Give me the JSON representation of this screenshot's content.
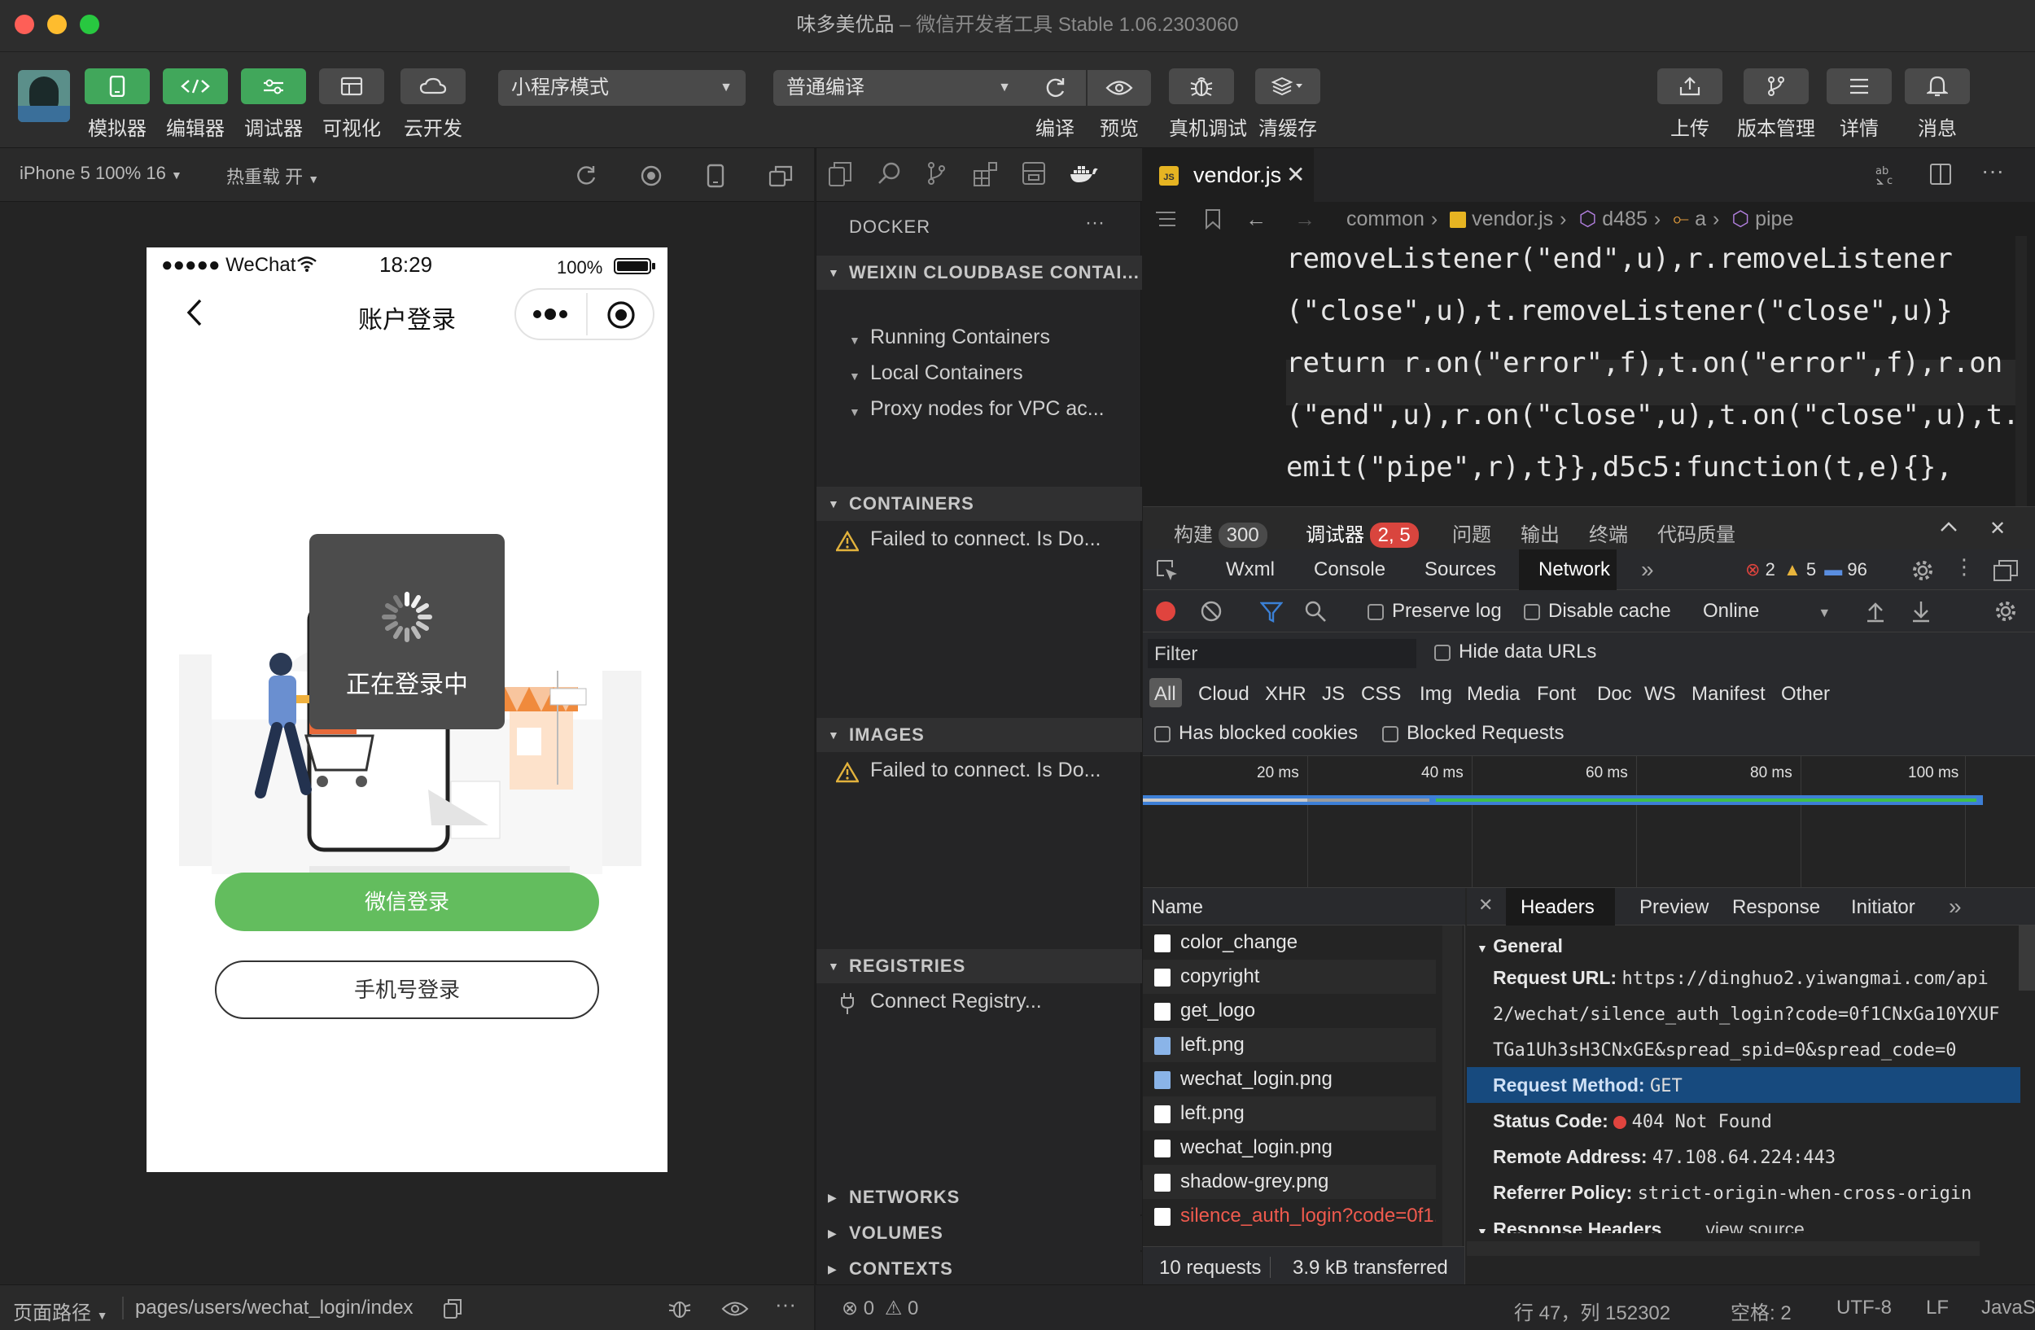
{
  "window": {
    "title": "味多美优品",
    "subtitle": "微信开发者工具 Stable 1.06.2303060"
  },
  "toolbar": {
    "simulator": "模拟器",
    "editor": "编辑器",
    "debugger": "调试器",
    "visual": "可视化",
    "cloud": "云开发",
    "mode_select": "小程序模式",
    "compile_select": "普通编译",
    "compile": "编译",
    "preview": "预览",
    "real_debug": "真机调试",
    "clear_cache": "清缓存",
    "upload": "上传",
    "version": "版本管理",
    "details": "详情",
    "messages": "消息"
  },
  "simbar": {
    "device": "iPhone 5 100% 16",
    "hot_reload": "热重载 开"
  },
  "phone": {
    "carrier": "●●●●● WeChat",
    "time": "18:29",
    "battery": "100%",
    "nav_title": "账户登录",
    "loading_text": "正在登录中",
    "wechat_login": "微信登录",
    "phone_login": "手机号登录"
  },
  "left_status": {
    "path_label": "页面路径",
    "path": "pages/users/wechat_login/index"
  },
  "docker": {
    "title": "DOCKER",
    "group": "WEIXIN CLOUDBASE CONTAI...",
    "items": [
      "Running Containers",
      "Local Containers",
      "Proxy nodes for VPC ac..."
    ],
    "containers_head": "CONTAINERS",
    "containers_msg": "Failed to connect. Is Do...",
    "images_head": "IMAGES",
    "images_msg": "Failed to connect. Is Do...",
    "registries_head": "REGISTRIES",
    "registries_msg": "Connect Registry...",
    "networks": "NETWORKS",
    "volumes": "VOLUMES",
    "contexts": "CONTEXTS"
  },
  "editor": {
    "tab": "vendor.js",
    "breadcrumb": [
      "common",
      "vendor.js",
      "d485",
      "a",
      "pipe"
    ],
    "lines": [
      "removeListener(\"end\",u),r.removeListener",
      "(\"close\",u),t.removeListener(\"close\",u)}",
      "return r.on(\"error\",f),t.on(\"error\",f),r.on",
      "(\"end\",u),r.on(\"close\",u),t.on(\"close\",u),t.",
      "emit(\"pipe\",r),t}},d5c5:function(t,e){},"
    ]
  },
  "panel_tabs": {
    "build": "构建",
    "build_count": "300",
    "debugger": "调试器",
    "debugger_count": "2, 5",
    "problems": "问题",
    "output": "输出",
    "terminal": "终端",
    "quality": "代码质量"
  },
  "devtools": {
    "tabs": [
      "Wxml",
      "Console",
      "Sources",
      "Network"
    ],
    "errors": "2",
    "warnings": "5",
    "infos": "96",
    "preserve_log": "Preserve log",
    "disable_cache": "Disable cache",
    "throttle": "Online",
    "filter_placeholder": "Filter",
    "hide_data_urls": "Hide data URLs",
    "types": [
      "All",
      "Cloud",
      "XHR",
      "JS",
      "CSS",
      "Img",
      "Media",
      "Font",
      "Doc",
      "WS",
      "Manifest",
      "Other"
    ],
    "blocked_cookies": "Has blocked cookies",
    "blocked_requests": "Blocked Requests",
    "timeline_ticks": [
      "20 ms",
      "40 ms",
      "60 ms",
      "80 ms",
      "100 ms"
    ],
    "name_header": "Name",
    "requests": [
      "color_change",
      "copyright",
      "get_logo",
      "left.png",
      "wechat_login.png",
      "left.png",
      "wechat_login.png",
      "shadow-grey.png",
      "silence_auth_login?code=0f1..."
    ],
    "summary_requests": "10 requests",
    "summary_transferred": "3.9 kB transferred",
    "detail_tabs": [
      "Headers",
      "Preview",
      "Response",
      "Initiator"
    ],
    "general": "General",
    "request_url_label": "Request URL:",
    "request_url": [
      "https://dinghuo2.yiwangmai.com/api",
      "2/wechat/silence_auth_login?code=0f1CNxGa10YXUF",
      "TGa1Uh3sH3CNxGE&spread_spid=0&spread_code=0"
    ],
    "method_label": "Request Method:",
    "method": "GET",
    "status_label": "Status Code:",
    "status": "404 Not Found",
    "remote_label": "Remote Address:",
    "remote": "47.108.64.224:443",
    "referrer_label": "Referrer Policy:",
    "referrer": "strict-origin-when-cross-origin",
    "response_headers": "Response Headers",
    "view_source": "view source"
  },
  "right_status": {
    "errors": "0",
    "warnings": "0",
    "position": "行 47，列 152302",
    "spaces": "空格: 2",
    "encoding": "UTF-8",
    "eol": "LF",
    "language": "JavaScript"
  },
  "colors": {
    "green": "#41a75b",
    "network_accent": "#3b80d6",
    "error": "#e0443e"
  }
}
